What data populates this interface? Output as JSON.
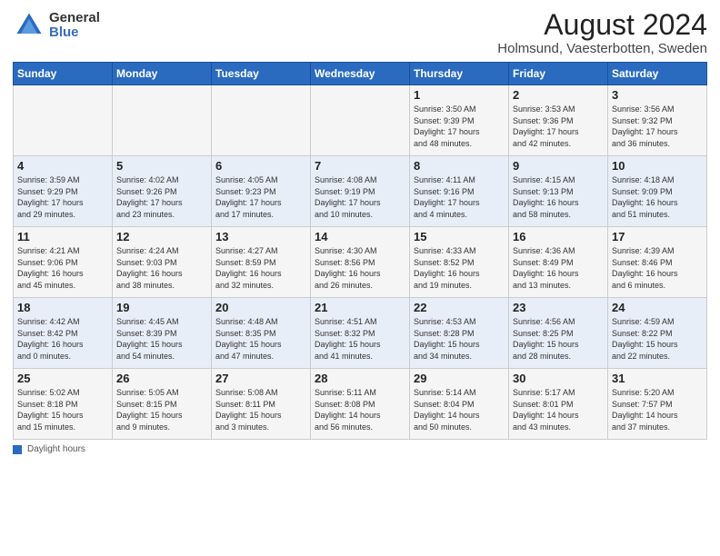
{
  "header": {
    "logo_general": "General",
    "logo_blue": "Blue",
    "month_title": "August 2024",
    "location": "Holmsund, Vaesterbotten, Sweden"
  },
  "days_of_week": [
    "Sunday",
    "Monday",
    "Tuesday",
    "Wednesday",
    "Thursday",
    "Friday",
    "Saturday"
  ],
  "weeks": [
    [
      {
        "day": "",
        "info": ""
      },
      {
        "day": "",
        "info": ""
      },
      {
        "day": "",
        "info": ""
      },
      {
        "day": "",
        "info": ""
      },
      {
        "day": "1",
        "info": "Sunrise: 3:50 AM\nSunset: 9:39 PM\nDaylight: 17 hours\nand 48 minutes."
      },
      {
        "day": "2",
        "info": "Sunrise: 3:53 AM\nSunset: 9:36 PM\nDaylight: 17 hours\nand 42 minutes."
      },
      {
        "day": "3",
        "info": "Sunrise: 3:56 AM\nSunset: 9:32 PM\nDaylight: 17 hours\nand 36 minutes."
      }
    ],
    [
      {
        "day": "4",
        "info": "Sunrise: 3:59 AM\nSunset: 9:29 PM\nDaylight: 17 hours\nand 29 minutes."
      },
      {
        "day": "5",
        "info": "Sunrise: 4:02 AM\nSunset: 9:26 PM\nDaylight: 17 hours\nand 23 minutes."
      },
      {
        "day": "6",
        "info": "Sunrise: 4:05 AM\nSunset: 9:23 PM\nDaylight: 17 hours\nand 17 minutes."
      },
      {
        "day": "7",
        "info": "Sunrise: 4:08 AM\nSunset: 9:19 PM\nDaylight: 17 hours\nand 10 minutes."
      },
      {
        "day": "8",
        "info": "Sunrise: 4:11 AM\nSunset: 9:16 PM\nDaylight: 17 hours\nand 4 minutes."
      },
      {
        "day": "9",
        "info": "Sunrise: 4:15 AM\nSunset: 9:13 PM\nDaylight: 16 hours\nand 58 minutes."
      },
      {
        "day": "10",
        "info": "Sunrise: 4:18 AM\nSunset: 9:09 PM\nDaylight: 16 hours\nand 51 minutes."
      }
    ],
    [
      {
        "day": "11",
        "info": "Sunrise: 4:21 AM\nSunset: 9:06 PM\nDaylight: 16 hours\nand 45 minutes."
      },
      {
        "day": "12",
        "info": "Sunrise: 4:24 AM\nSunset: 9:03 PM\nDaylight: 16 hours\nand 38 minutes."
      },
      {
        "day": "13",
        "info": "Sunrise: 4:27 AM\nSunset: 8:59 PM\nDaylight: 16 hours\nand 32 minutes."
      },
      {
        "day": "14",
        "info": "Sunrise: 4:30 AM\nSunset: 8:56 PM\nDaylight: 16 hours\nand 26 minutes."
      },
      {
        "day": "15",
        "info": "Sunrise: 4:33 AM\nSunset: 8:52 PM\nDaylight: 16 hours\nand 19 minutes."
      },
      {
        "day": "16",
        "info": "Sunrise: 4:36 AM\nSunset: 8:49 PM\nDaylight: 16 hours\nand 13 minutes."
      },
      {
        "day": "17",
        "info": "Sunrise: 4:39 AM\nSunset: 8:46 PM\nDaylight: 16 hours\nand 6 minutes."
      }
    ],
    [
      {
        "day": "18",
        "info": "Sunrise: 4:42 AM\nSunset: 8:42 PM\nDaylight: 16 hours\nand 0 minutes."
      },
      {
        "day": "19",
        "info": "Sunrise: 4:45 AM\nSunset: 8:39 PM\nDaylight: 15 hours\nand 54 minutes."
      },
      {
        "day": "20",
        "info": "Sunrise: 4:48 AM\nSunset: 8:35 PM\nDaylight: 15 hours\nand 47 minutes."
      },
      {
        "day": "21",
        "info": "Sunrise: 4:51 AM\nSunset: 8:32 PM\nDaylight: 15 hours\nand 41 minutes."
      },
      {
        "day": "22",
        "info": "Sunrise: 4:53 AM\nSunset: 8:28 PM\nDaylight: 15 hours\nand 34 minutes."
      },
      {
        "day": "23",
        "info": "Sunrise: 4:56 AM\nSunset: 8:25 PM\nDaylight: 15 hours\nand 28 minutes."
      },
      {
        "day": "24",
        "info": "Sunrise: 4:59 AM\nSunset: 8:22 PM\nDaylight: 15 hours\nand 22 minutes."
      }
    ],
    [
      {
        "day": "25",
        "info": "Sunrise: 5:02 AM\nSunset: 8:18 PM\nDaylight: 15 hours\nand 15 minutes."
      },
      {
        "day": "26",
        "info": "Sunrise: 5:05 AM\nSunset: 8:15 PM\nDaylight: 15 hours\nand 9 minutes."
      },
      {
        "day": "27",
        "info": "Sunrise: 5:08 AM\nSunset: 8:11 PM\nDaylight: 15 hours\nand 3 minutes."
      },
      {
        "day": "28",
        "info": "Sunrise: 5:11 AM\nSunset: 8:08 PM\nDaylight: 14 hours\nand 56 minutes."
      },
      {
        "day": "29",
        "info": "Sunrise: 5:14 AM\nSunset: 8:04 PM\nDaylight: 14 hours\nand 50 minutes."
      },
      {
        "day": "30",
        "info": "Sunrise: 5:17 AM\nSunset: 8:01 PM\nDaylight: 14 hours\nand 43 minutes."
      },
      {
        "day": "31",
        "info": "Sunrise: 5:20 AM\nSunset: 7:57 PM\nDaylight: 14 hours\nand 37 minutes."
      }
    ]
  ],
  "footer": {
    "daylight_label": "Daylight hours"
  }
}
